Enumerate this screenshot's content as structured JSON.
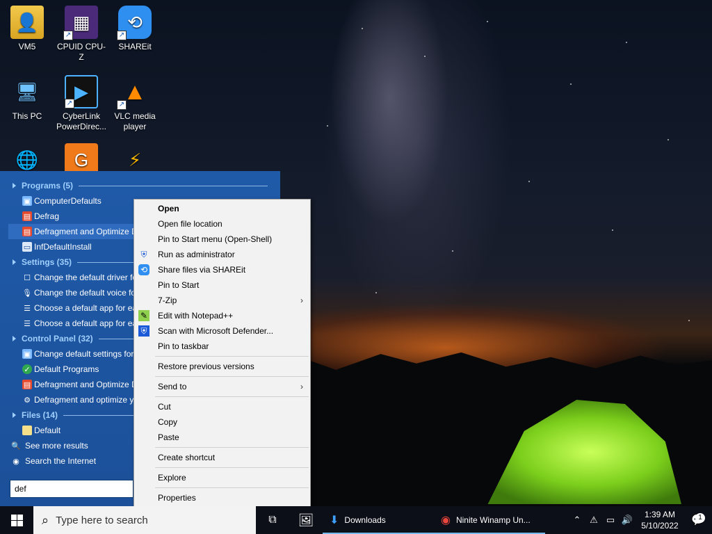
{
  "desktop": {
    "icons": [
      {
        "label": "VM5",
        "icon": "user-folder-icon"
      },
      {
        "label": "CPUID CPU-Z",
        "icon": "cpuz-icon"
      },
      {
        "label": "SHAREit",
        "icon": "shareit-icon"
      },
      {
        "label": "This PC",
        "icon": "computer-icon"
      },
      {
        "label": "CyberLink PowerDirec...",
        "icon": "powerdirector-icon"
      },
      {
        "label": "VLC media player",
        "icon": "vlc-icon"
      }
    ]
  },
  "start_menu": {
    "categories": [
      {
        "label": "Programs (5)",
        "items": [
          "ComputerDefaults",
          "Defrag",
          "Defragment and Optimize Drives",
          "InfDefaultInstall"
        ]
      },
      {
        "label": "Settings (35)",
        "items": [
          "Change the default driver for a device",
          "Change the default voice for speech",
          "Choose a default app for each type of file",
          "Choose a default app for each protocol"
        ]
      },
      {
        "label": "Control Panel (32)",
        "items": [
          "Change default settings for media or devices",
          "Default Programs",
          "Defragment and Optimize Drives",
          "Defragment and optimize your drives"
        ]
      },
      {
        "label": "Files (14)",
        "items": [
          "Default"
        ]
      }
    ],
    "see_more": "See more results",
    "search_internet": "Search the Internet",
    "search_value": "def"
  },
  "context_menu": {
    "items": [
      "Open",
      "Open file location",
      "Pin to Start menu (Open-Shell)",
      "Run as administrator",
      "Share files via SHAREit",
      "Pin to Start",
      "7-Zip",
      "Edit with Notepad++",
      "Scan with Microsoft Defender...",
      "Pin to taskbar",
      "Restore previous versions",
      "Send to",
      "Cut",
      "Copy",
      "Paste",
      "Create shortcut",
      "Explore",
      "Properties"
    ]
  },
  "taskbar": {
    "search_placeholder": "Type here to search",
    "apps": [
      "Downloads",
      "Ninite Winamp Un..."
    ],
    "time": "1:39 AM",
    "date": "5/10/2022",
    "notification_count": "1"
  },
  "colors": {
    "start_menu_bg": "#1f5aa8",
    "category_text": "#9fd0ff",
    "taskbar_bg": "#0c0f17"
  }
}
